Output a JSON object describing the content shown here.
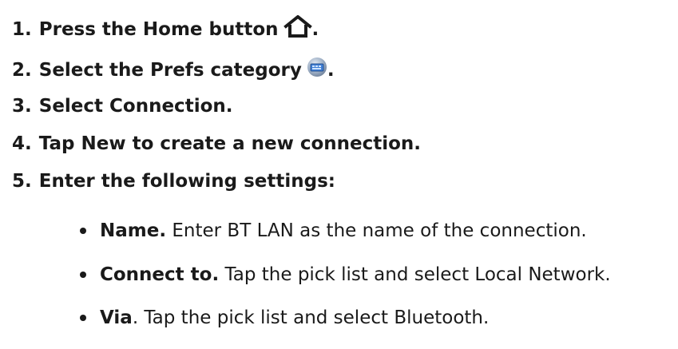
{
  "steps": [
    {
      "number": "1.",
      "text": "Press the Home button",
      "icon": "home-icon",
      "trailing": "."
    },
    {
      "number": "2.",
      "text": "Select the Prefs category",
      "icon": "prefs-icon",
      "trailing": "."
    },
    {
      "number": "3.",
      "text": "Select Connection."
    },
    {
      "number": "4.",
      "text": "Tap New to create a new connection."
    },
    {
      "number": "5.",
      "text": "Enter the following settings:"
    }
  ],
  "settings": [
    {
      "term": "Name.",
      "desc": " Enter BT LAN as the name of the connection."
    },
    {
      "term": "Connect to.",
      "desc": " Tap the pick list and select Local Network."
    },
    {
      "term": "Via",
      "desc": ". Tap the pick list and select Bluetooth."
    }
  ]
}
